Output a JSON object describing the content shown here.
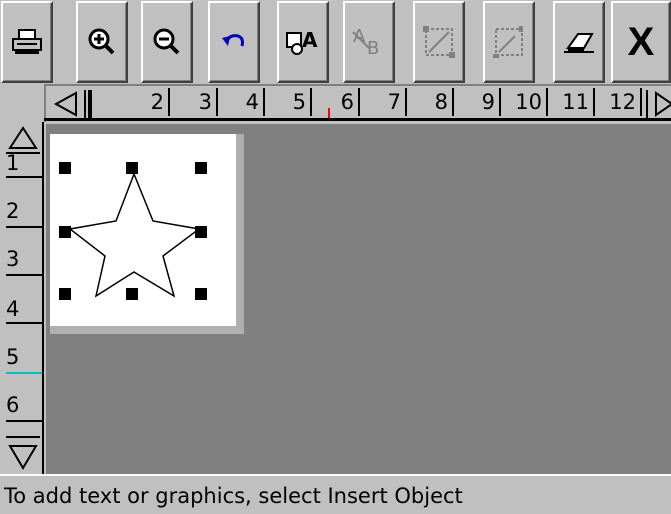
{
  "toolbar": {
    "buttons": [
      {
        "icon": "printer-icon",
        "enabled": true
      },
      {
        "icon": "zoom-in-icon",
        "enabled": true
      },
      {
        "icon": "zoom-out-icon",
        "enabled": true
      },
      {
        "icon": "undo-icon",
        "enabled": true
      },
      {
        "icon": "insert-object-icon",
        "enabled": true
      },
      {
        "icon": "text-properties-icon",
        "enabled": false
      },
      {
        "icon": "align-object-icon",
        "enabled": false
      },
      {
        "icon": "resize-object-icon",
        "enabled": false
      },
      {
        "icon": "eraser-icon",
        "enabled": true
      },
      {
        "icon": "close-icon",
        "label": "X",
        "enabled": true
      }
    ]
  },
  "hruler": {
    "labels": [
      "2",
      "3",
      "4",
      "5",
      "6",
      "7",
      "8",
      "9",
      "10",
      "11",
      "12"
    ],
    "marker_color": "#ff0000"
  },
  "vruler": {
    "labels": [
      "1",
      "2",
      "3",
      "4",
      "5",
      "6"
    ],
    "marker_color": "#00c0c0"
  },
  "colors": {
    "background": "#c0c0c0",
    "canvas": "#808080",
    "label": "#ffffff",
    "handles": "#000000"
  },
  "status": {
    "text": "To add text or graphics, select Insert Object"
  }
}
